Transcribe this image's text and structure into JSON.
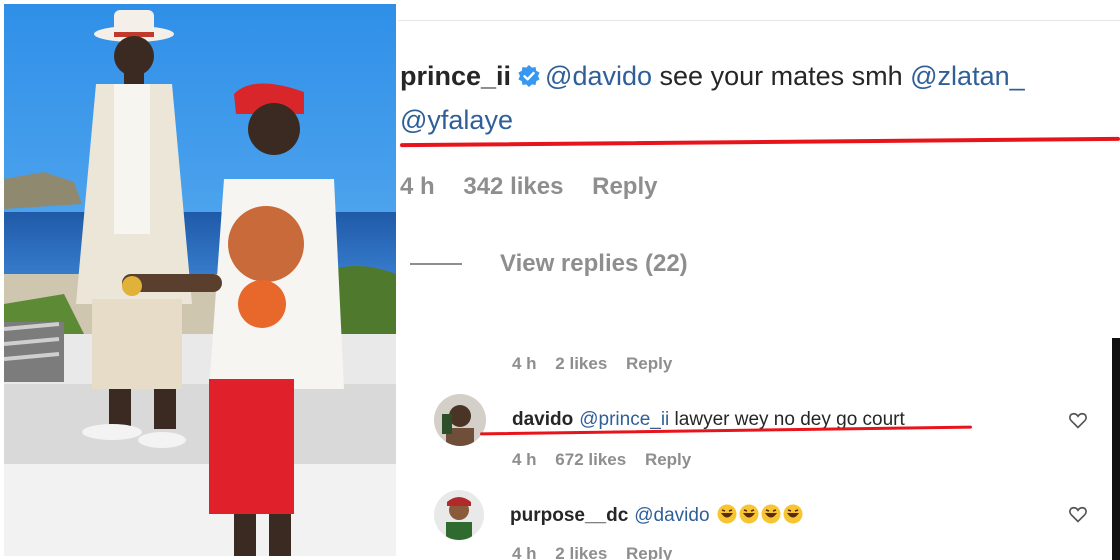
{
  "photo": {
    "alt_icon": "post-photo"
  },
  "main_comment": {
    "username": "prince_ii",
    "verified_icon": "verified-badge-icon",
    "mention_1": "@davido",
    "text": " see your mates smh ",
    "mention_2": "@zlatan_",
    "mention_3": "@yfalaye",
    "time": "4 h",
    "likes": "342 likes",
    "reply": "Reply"
  },
  "view_replies": "View replies (22)",
  "replies": [
    {
      "meta_time": "4 h",
      "meta_likes": "2 likes",
      "meta_reply": "Reply"
    },
    {
      "username": "davido",
      "mention": "@prince_ii",
      "text": " lawyer wey no dey go court",
      "time": "4 h",
      "likes": "672 likes",
      "reply": "Reply",
      "like_icon": "heart-icon"
    },
    {
      "username": "purpose__dc",
      "mention": "@davido",
      "emojis": "😂😂😂😂",
      "time": "4 h",
      "likes": "2 likes",
      "reply": "Reply",
      "like_icon": "heart-icon"
    }
  ],
  "colors": {
    "underline": "#e8141b",
    "mention": "#2f5f99",
    "meta": "#8e8e8e",
    "text": "#262626"
  }
}
